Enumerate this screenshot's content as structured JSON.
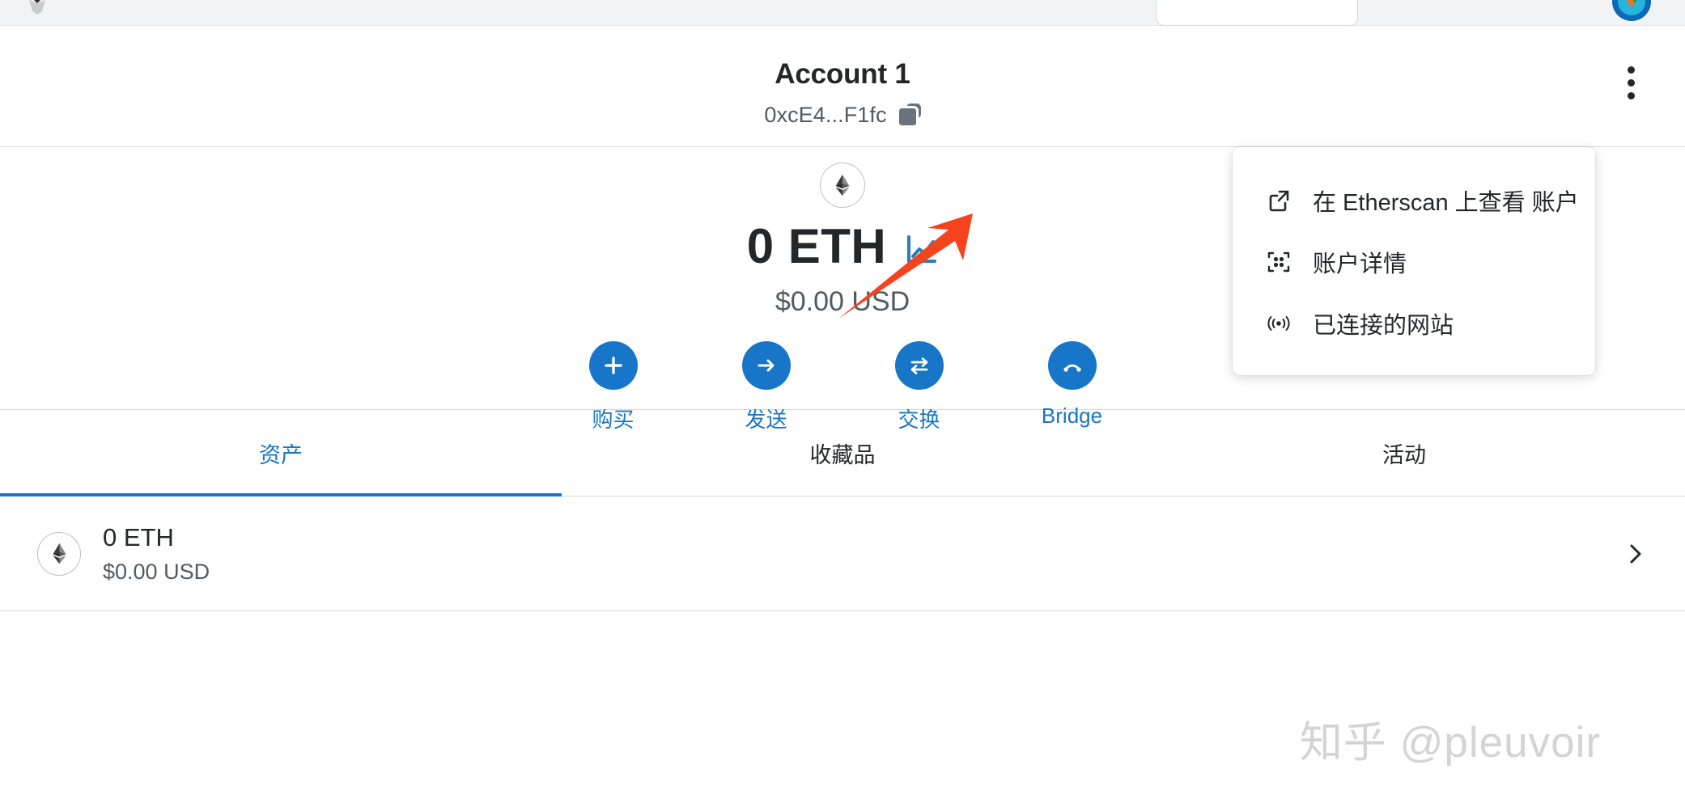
{
  "browser": {
    "fox_icon": "firefox-logo-icon",
    "address_pill": "",
    "globe_icon": "browser-extension-icon"
  },
  "header": {
    "account_name": "Account 1",
    "account_address": "0xcE4...F1fc",
    "copy_icon": "copy-icon",
    "menu_icon": "kebab-menu-icon"
  },
  "balance": {
    "token_icon": "ethereum-icon",
    "amount": "0 ETH",
    "portfolio_icon": "line-chart-icon",
    "fiat": "$0.00 USD"
  },
  "actions": [
    {
      "label": "购买",
      "icon": "plus-icon"
    },
    {
      "label": "发送",
      "icon": "arrow-right-icon"
    },
    {
      "label": "交换",
      "icon": "swap-arrows-icon"
    },
    {
      "label": "Bridge",
      "icon": "bridge-arc-icon"
    }
  ],
  "tabs": [
    {
      "label": "资产",
      "active": true
    },
    {
      "label": "收藏品",
      "active": false
    },
    {
      "label": "活动",
      "active": false
    }
  ],
  "assets": [
    {
      "icon": "ethereum-icon",
      "primary": "0 ETH",
      "secondary": "$0.00 USD",
      "chevron": "chevron-right-icon"
    }
  ],
  "dropdown": {
    "items": [
      {
        "label": "在 Etherscan 上查看 账户",
        "icon": "external-link-icon"
      },
      {
        "label": "账户详情",
        "icon": "qr-code-icon"
      },
      {
        "label": "已连接的网站",
        "icon": "broadcast-icon"
      }
    ]
  },
  "annotation": {
    "arrow_color": "#F4441E",
    "arrow_icon": "pointer-arrow-icon"
  },
  "watermark": {
    "text": "知乎 @pleuvoir"
  },
  "colors": {
    "accent_blue": "#1776c8",
    "text_primary": "#24272a",
    "text_secondary": "#535a61",
    "border": "#d6d9dc"
  }
}
